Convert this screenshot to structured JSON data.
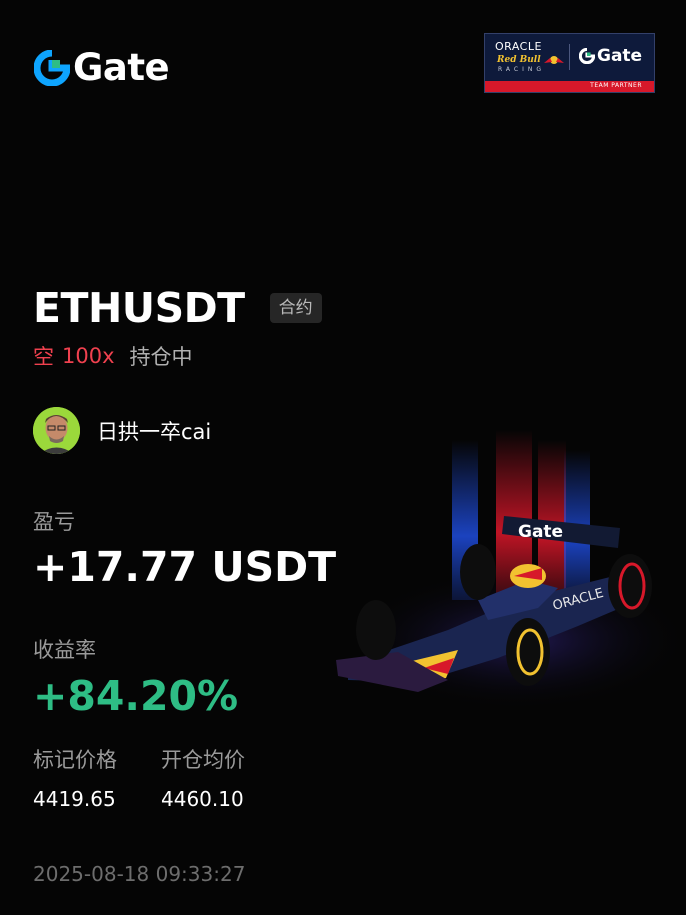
{
  "brand": {
    "name": "Gate",
    "accent": "#0ea5ff",
    "accent_green": "#2ebd85"
  },
  "partner_badge": {
    "oracle": "ORACLE",
    "redbull": "Red Bull",
    "racing": "RACING",
    "gate": "Gate",
    "footer": "TEAM PARTNER"
  },
  "position": {
    "symbol": "ETHUSDT",
    "type_tag": "合约",
    "direction": "空",
    "leverage": "100x",
    "status": "持仓中"
  },
  "user": {
    "name": "日拱一卒cai",
    "avatar_icon": "user-avatar"
  },
  "pnl": {
    "label": "盈亏",
    "value": "+17.77 USDT"
  },
  "roi": {
    "label": "收益率",
    "value": "+84.20%"
  },
  "prices": {
    "mark_label": "标记价格",
    "entry_label": "开仓均价",
    "mark_value": "4419.65",
    "entry_value": "4460.10"
  },
  "timestamp": "2025-08-18 09:33:27",
  "car_wing_text": "Gate",
  "colors": {
    "short": "#f0414f",
    "profit": "#2ebd85",
    "muted": "#9a9a9a"
  }
}
